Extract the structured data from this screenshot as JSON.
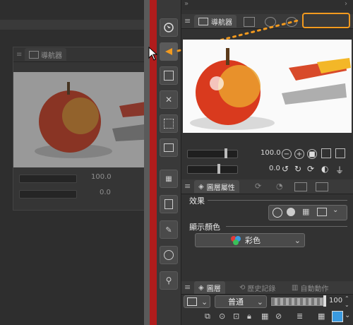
{
  "navigator_tab": "導航器",
  "navigator_zoom": "100.0",
  "navigator_angle": "0.0",
  "props_tab": "圖層屬性",
  "effect_label": "效果",
  "display_color_label": "顯示顏色",
  "display_color_value": "彩色",
  "layer_tabs": [
    "圖層",
    "歷史記錄",
    "自動動作"
  ],
  "blend_mode": "普通",
  "opacity_value": "100",
  "colors": {
    "accent_orange": "#f29a1f",
    "divider_red": "#b01c1c",
    "panel_bg": "#323232"
  },
  "icons": [
    "navigator-icon",
    "chevron-down-icon",
    "refresh-icon",
    "zoom-in-icon",
    "zoom-out-icon",
    "fit-icon",
    "flip-icon",
    "lock-icon",
    "rotate-icon",
    "layer-icon",
    "history-icon",
    "auto-action-icon",
    "color-wheel-icon",
    "transparency-icon",
    "folder-icon",
    "cursor-icon"
  ]
}
